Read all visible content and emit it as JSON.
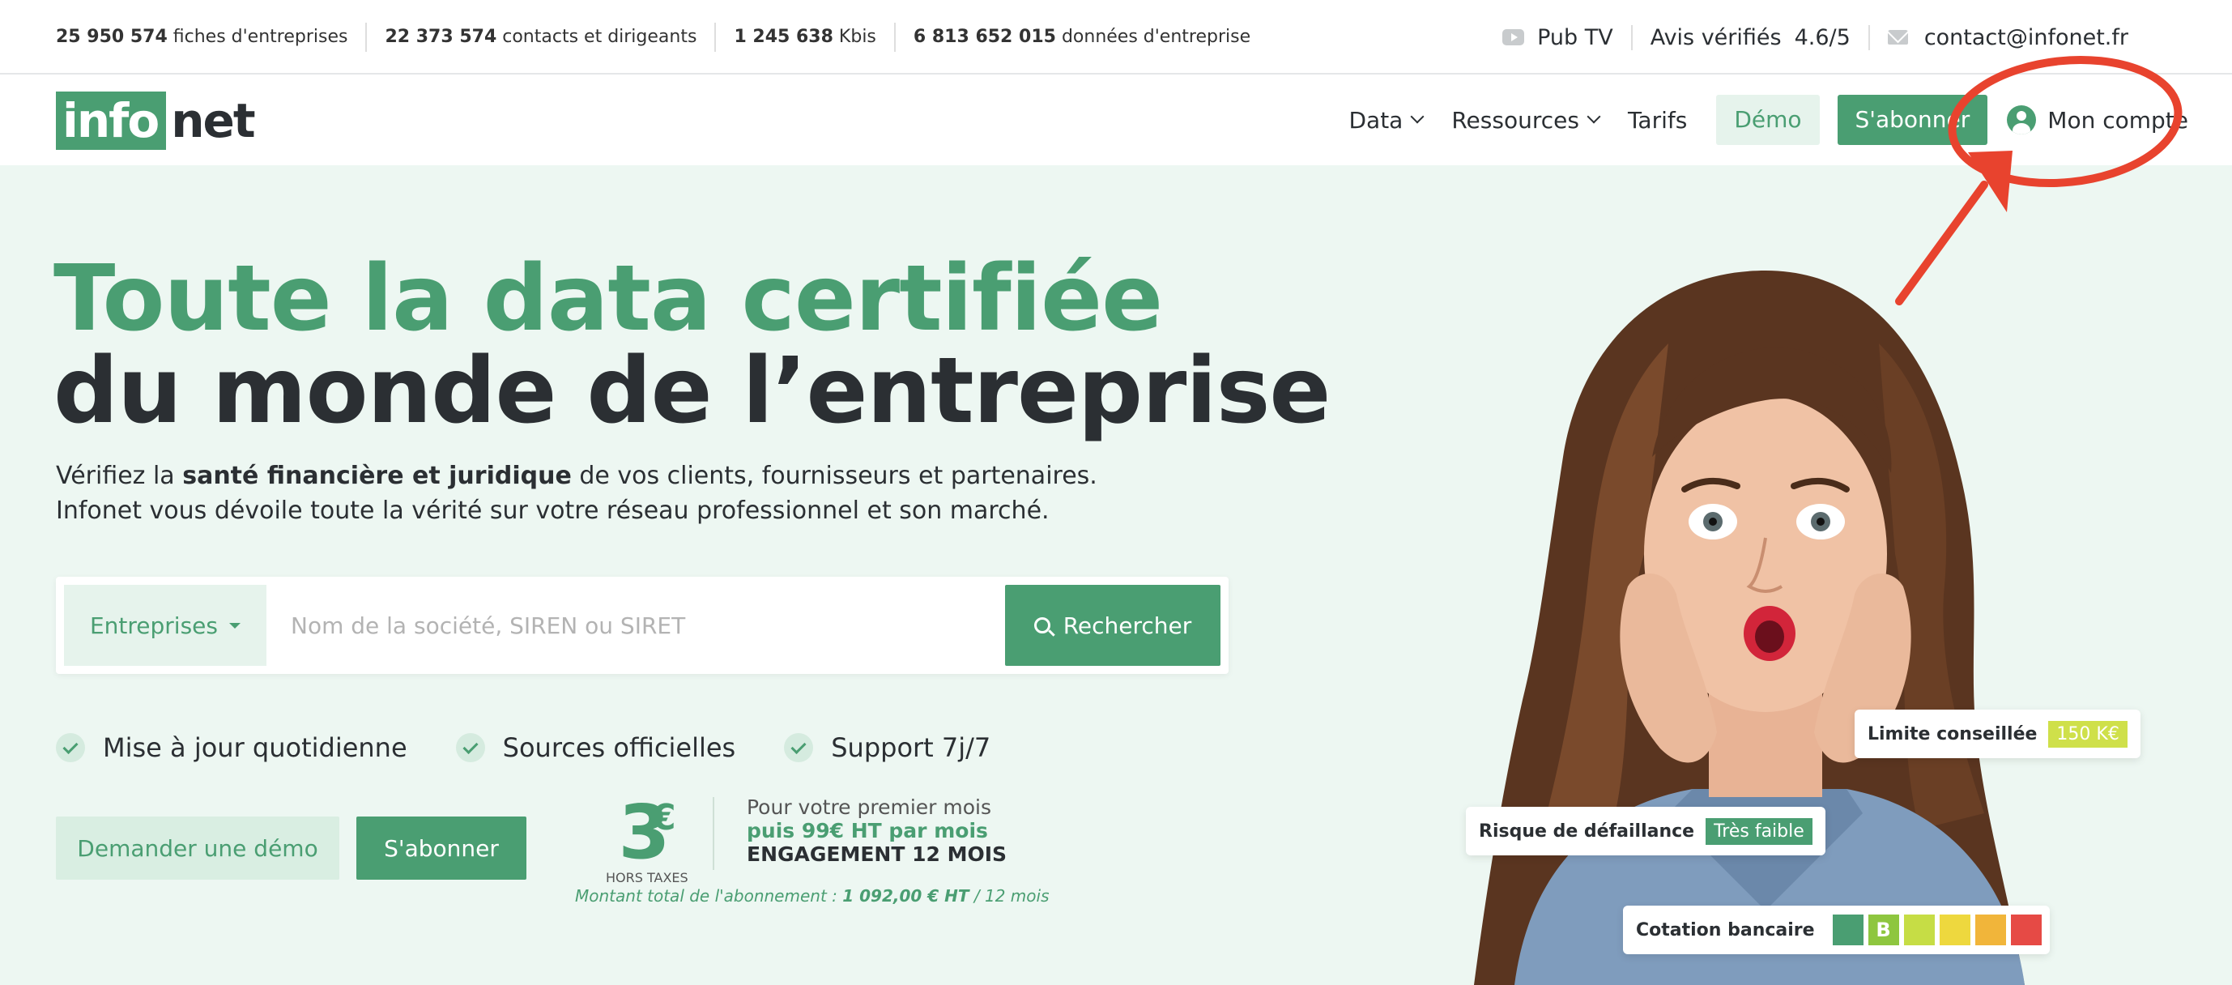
{
  "topbar": {
    "stats": [
      {
        "num": "25 950 574",
        "label": "fiches d'entreprises"
      },
      {
        "num": "22 373 574",
        "label": "contacts et dirigeants"
      },
      {
        "num": "1 245 638",
        "label": "Kbis"
      },
      {
        "num": "6 813 652 015",
        "label": "données d'entreprise"
      }
    ],
    "pub_tv": "Pub TV",
    "avis_label": "Avis vérifiés",
    "avis_score": "4.6/5",
    "email": "contact@infonet.fr"
  },
  "nav": {
    "logo_box": "info",
    "logo_rest": "net",
    "data": "Data",
    "ressources": "Ressources",
    "tarifs": "Tarifs",
    "demo": "Démo",
    "subscribe": "S'abonner",
    "account": "Mon compte"
  },
  "hero": {
    "title_line1": "Toute la data certifiée",
    "title_line2": "du monde de l’entreprise",
    "lead_pre": "Vérifiez la ",
    "lead_bold": "santé financière et juridique",
    "lead_post": " de vos clients, fournisseurs et partenaires.",
    "lead_line2": "Infonet vous dévoile toute la vérité sur votre réseau professionnel et son marché."
  },
  "search": {
    "category": "Entreprises",
    "placeholder": "Nom de la société, SIREN ou SIRET",
    "value": "",
    "button": "Rechercher"
  },
  "features": [
    "Mise à jour quotidienne",
    "Sources officielles",
    "Support 7j/7"
  ],
  "cta": {
    "demo": "Demander une démo",
    "subscribe": "S'abonner"
  },
  "pricing": {
    "amount": "3",
    "currency": "€",
    "tax": "HORS TAXES",
    "line1": "Pour votre premier mois",
    "line2": "puis 99€ HT par mois",
    "line3": "ENGAGEMENT 12 MOIS",
    "total_pre": "Montant total de l'abonnement : ",
    "total_amount": "1 092,00 € HT",
    "total_post": " / 12 mois"
  },
  "tags": {
    "limit_label": "Limite conseillée",
    "limit_value": "150 K€",
    "risk_label": "Risque de défaillance",
    "risk_value": "Très faible",
    "rating_label": "Cotation bancaire",
    "rating_selected": "B"
  },
  "colors": {
    "brand_green": "#4a9e72",
    "hero_bg": "#edf7f2",
    "annotation_red": "#e8432e"
  }
}
